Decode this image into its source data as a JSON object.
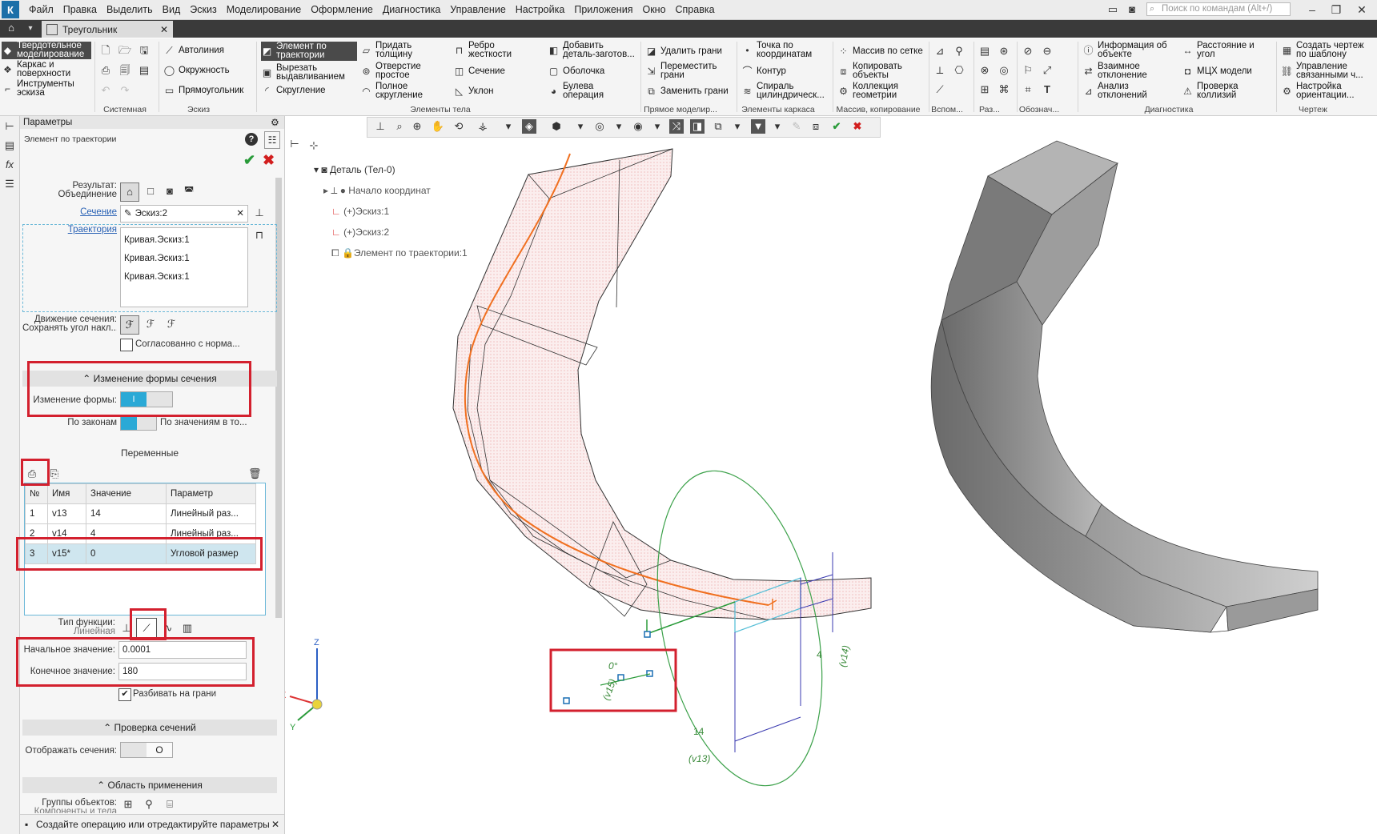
{
  "menu": {
    "logo": "К",
    "items": [
      "Файл",
      "Правка",
      "Выделить",
      "Вид",
      "Эскиз",
      "Моделирование",
      "Оформление",
      "Диагностика",
      "Управление",
      "Настройка",
      "Приложения",
      "Окно",
      "Справка"
    ],
    "search_placeholder": "Поиск по командам (Alt+/)"
  },
  "tab": {
    "title": "Треугольник",
    "close": "✕"
  },
  "ribbon": {
    "modes": [
      {
        "label1": "Твердотельное",
        "label2": "моделирование",
        "active": true
      },
      {
        "label1": "Каркас и",
        "label2": "поверхности",
        "active": false
      },
      {
        "label1": "Инструменты",
        "label2": "эскиза",
        "active": false
      }
    ],
    "sketch": [
      "Автолиния",
      "Окружность",
      "Прямоугольник"
    ],
    "body1": [
      {
        "label1": "Элемент по",
        "label2": "траектории",
        "active": true
      },
      {
        "label1": "Вырезать",
        "label2": "выдавливанием",
        "active": false
      },
      {
        "label1": "Скругление",
        "label2": "",
        "active": false
      }
    ],
    "body2": [
      {
        "label1": "Придать",
        "label2": "толщину"
      },
      {
        "label1": "Отверстие",
        "label2": "простое"
      },
      {
        "label1": "Полное",
        "label2": "скругление"
      }
    ],
    "body3": [
      {
        "label1": "Ребро",
        "label2": "жесткости"
      },
      {
        "label1": "Сечение",
        "label2": ""
      },
      {
        "label1": "Уклон",
        "label2": ""
      }
    ],
    "body4": [
      {
        "label1": "Добавить",
        "label2": "деталь-заготов..."
      },
      {
        "label1": "Оболочка",
        "label2": ""
      },
      {
        "label1": "Булева",
        "label2": "операция"
      }
    ],
    "direct": [
      {
        "label1": "Удалить грани",
        "label2": ""
      },
      {
        "label1": "Переместить",
        "label2": "грани"
      },
      {
        "label1": "Заменить грани",
        "label2": ""
      }
    ],
    "frame": [
      {
        "label1": "Точка по",
        "label2": "координатам"
      },
      {
        "label1": "Контур",
        "label2": ""
      },
      {
        "label1": "Спираль",
        "label2": "цилиндрическ..."
      }
    ],
    "array": [
      {
        "label1": "Массив по сетке",
        "label2": ""
      },
      {
        "label1": "Копировать",
        "label2": "объекты"
      },
      {
        "label1": "Коллекция",
        "label2": "геометрии"
      }
    ],
    "diag": [
      {
        "label1": "Информация об",
        "label2": "объекте"
      },
      {
        "label1": "Взаимное",
        "label2": "отклонение"
      },
      {
        "label1": "Анализ",
        "label2": "отклонений"
      }
    ],
    "diag2": [
      {
        "label1": "Расстояние и",
        "label2": "угол"
      },
      {
        "label1": "МЦХ модели",
        "label2": ""
      },
      {
        "label1": "Проверка",
        "label2": "коллизий"
      }
    ],
    "drawing": [
      {
        "label1": "Создать чертеж",
        "label2": "по шаблону"
      },
      {
        "label1": "Управление",
        "label2": "связанными ч..."
      },
      {
        "label1": "Настройка",
        "label2": "ориентации..."
      }
    ],
    "groups": [
      "Системная",
      "Эскиз",
      "Элементы тела",
      "Прямое моделир...",
      "Элементы каркаса",
      "Массив, копирование",
      "Вспом...",
      "Раз...",
      "Обознач...",
      "Диагностика",
      "Чертеж"
    ]
  },
  "panel": {
    "header": "Параметры",
    "operation": "Элемент по траектории",
    "result_label": "Результат:",
    "result_value": "Объединение",
    "section_link": "Сечение",
    "section_value": "Эскиз:2",
    "trajectory_link": "Траектория",
    "trajectory_items": [
      "Кривая.Эскиз:1",
      "Кривая.Эскиз:1",
      "Кривая.Эскиз:1"
    ],
    "motion_label": "Движение сечения:",
    "motion_value": "Сохранять угол накл...",
    "normal_label": "Согласованно с норма...",
    "shape_change_header": "Изменение формы сечения",
    "shape_change_label": "Изменение формы:",
    "shape_toggle_text": "I",
    "by_laws_label": "По законам",
    "by_values_label": "По значениям в то...",
    "variables_title": "Переменные",
    "table": {
      "headers": [
        "№",
        "Имя",
        "Значение",
        "Параметр"
      ],
      "rows": [
        [
          "1",
          "v13",
          "14",
          "Линейный раз..."
        ],
        [
          "2",
          "v14",
          "4",
          "Линейный раз..."
        ],
        [
          "3",
          "v15*",
          "0",
          "Угловой размер"
        ]
      ]
    },
    "func_type_label": "Тип функции:",
    "func_type_value": "Линейная",
    "start_label": "Начальное значение:",
    "start_value": "0.0001",
    "end_label": "Конечное значение:",
    "end_value": "180",
    "split_label": "Разбивать на грани",
    "check_header": "Проверка сечений",
    "show_sections_label": "Отображать сечения:",
    "show_toggle_text": "O",
    "scope_header": "Область применения",
    "groups_label": "Группы объектов:",
    "groups_value": "Компоненты и тела"
  },
  "tree": {
    "root": "Деталь (Тел-0)",
    "items": [
      "Начало координат",
      "(+)Эскиз:1",
      "(+)Эскиз:2",
      "Элемент по траектории:1"
    ]
  },
  "status": "Создайте операцию или отредактируйте параметры",
  "viewport": {
    "dim_angle": "0°",
    "dim_v15": "(v15)",
    "dim_14": "14",
    "dim_v13": "(v13)",
    "dim_4": "4",
    "dim_v14": "(v14)",
    "axis_x": "X",
    "axis_y": "Y",
    "axis_z": "Z"
  },
  "colors": {
    "accent": "#2aa9d6",
    "highlight": "#d3202e",
    "path": "#f07020",
    "ok": "#2a9b3a"
  }
}
